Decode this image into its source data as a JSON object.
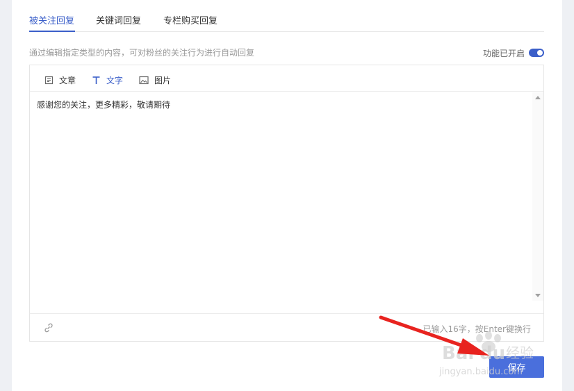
{
  "tabs": [
    {
      "label": "被关注回复",
      "active": true
    },
    {
      "label": "关键词回复",
      "active": false
    },
    {
      "label": "专栏购买回复",
      "active": false
    }
  ],
  "description": "通过编辑指定类型的内容，可对粉丝的关注行为进行自动回复",
  "status": {
    "label": "功能已开启",
    "enabled": true
  },
  "toolbar": {
    "items": [
      {
        "label": "文章",
        "icon": "article-icon",
        "active": false
      },
      {
        "label": "文字",
        "icon": "text-icon",
        "active": true
      },
      {
        "label": "图片",
        "icon": "image-icon",
        "active": false
      }
    ]
  },
  "editor": {
    "content": "感谢您的关注，更多精彩，敬请期待",
    "counter": "已输入16字，按Enter键换行"
  },
  "save_label": "保存",
  "colors": {
    "accent": "#3b5fc9",
    "button": "#4a6fdc",
    "arrow": "#e8231f"
  }
}
